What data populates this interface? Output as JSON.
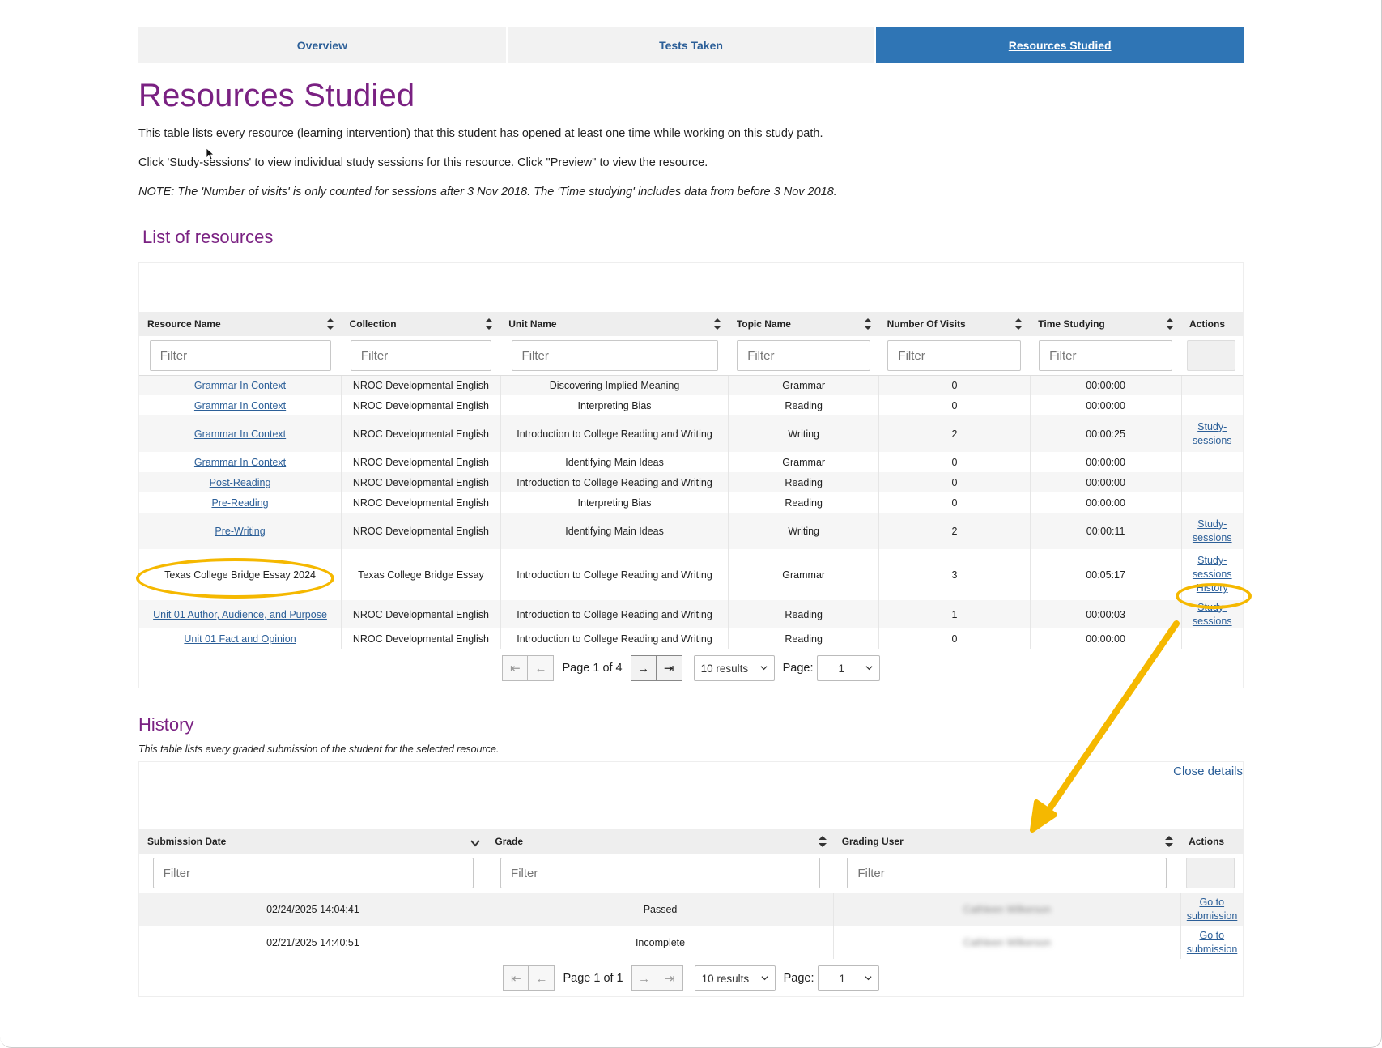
{
  "tabs": [
    {
      "label": "Overview",
      "active": false
    },
    {
      "label": "Tests Taken",
      "active": false
    },
    {
      "label": "Resources Studied",
      "active": true
    }
  ],
  "page_title": "Resources Studied",
  "intro": {
    "line1": "This table lists every resource (learning intervention) that this student has opened at least one time while working on this study path.",
    "line2": "Click 'Study-sessions' to view individual study sessions for this resource. Click \"Preview\" to view the resource.",
    "note": "NOTE: The 'Number of visits' is only counted for sessions after 3 Nov 2018. The 'Time studying' includes data from before 3 Nov 2018."
  },
  "resources": {
    "title": "List of resources",
    "columns": [
      "Resource Name",
      "Collection",
      "Unit Name",
      "Topic Name",
      "Number Of Visits",
      "Time Studying",
      "Actions"
    ],
    "filter_placeholder": "Filter",
    "rows": [
      {
        "name": "Grammar In Context",
        "collection": "NROC Developmental English",
        "unit": "Discovering Implied Meaning",
        "topic": "Grammar",
        "visits": "0",
        "time": "00:00:00",
        "actions": []
      },
      {
        "name": "Grammar In Context",
        "collection": "NROC Developmental English",
        "unit": "Interpreting Bias",
        "topic": "Reading",
        "visits": "0",
        "time": "00:00:00",
        "actions": []
      },
      {
        "name": "Grammar In Context",
        "collection": "NROC Developmental English",
        "unit": "Introduction to College Reading and Writing",
        "topic": "Writing",
        "visits": "2",
        "time": "00:00:25",
        "actions": [
          "Study-sessions"
        ]
      },
      {
        "name": "Grammar In Context",
        "collection": "NROC Developmental English",
        "unit": "Identifying Main Ideas",
        "topic": "Grammar",
        "visits": "0",
        "time": "00:00:00",
        "actions": []
      },
      {
        "name": "Post-Reading",
        "collection": "NROC Developmental English",
        "unit": "Introduction to College Reading and Writing",
        "topic": "Reading",
        "visits": "0",
        "time": "00:00:00",
        "actions": []
      },
      {
        "name": "Pre-Reading",
        "collection": "NROC Developmental English",
        "unit": "Interpreting Bias",
        "topic": "Reading",
        "visits": "0",
        "time": "00:00:00",
        "actions": []
      },
      {
        "name": "Pre-Writing",
        "collection": "NROC Developmental English",
        "unit": "Identifying Main Ideas",
        "topic": "Writing",
        "visits": "2",
        "time": "00:00:11",
        "actions": [
          "Study-sessions"
        ]
      },
      {
        "name": "Texas College Bridge Essay 2024",
        "collection": "Texas College Bridge Essay",
        "unit": "Introduction to College Reading and Writing",
        "topic": "Grammar",
        "visits": "3",
        "time": "00:05:17",
        "actions": [
          "Study-sessions",
          "History"
        ],
        "plain": true
      },
      {
        "name": "Unit 01 Author, Audience, and Purpose",
        "collection": "NROC Developmental English",
        "unit": "Introduction to College Reading and Writing",
        "topic": "Reading",
        "visits": "1",
        "time": "00:00:03",
        "actions": [
          "Study-sessions"
        ]
      },
      {
        "name": "Unit 01 Fact and Opinion",
        "collection": "NROC Developmental English",
        "unit": "Introduction to College Reading and Writing",
        "topic": "Reading",
        "visits": "0",
        "time": "00:00:00",
        "actions": []
      }
    ],
    "pager": {
      "page_text": "Page 1 of 4",
      "results": "10 results",
      "page_label": "Page:",
      "page_value": "1"
    }
  },
  "history": {
    "title": "History",
    "description": "This table lists every graded submission of the student for the selected resource.",
    "close_label": "Close details",
    "columns": [
      "Submission Date",
      "Grade",
      "Grading User",
      "Actions"
    ],
    "filter_placeholder": "Filter",
    "rows": [
      {
        "date": "02/24/2025 14:04:41",
        "grade": "Passed",
        "user": "Cathleen Wilkerson",
        "action": "Go to submission"
      },
      {
        "date": "02/21/2025 14:40:51",
        "grade": "Incomplete",
        "user": "Cathleen Wilkerson",
        "action": "Go to submission"
      }
    ],
    "pager": {
      "page_text": "Page 1 of 1",
      "results": "10 results",
      "page_label": "Page:",
      "page_value": "1"
    }
  },
  "annotation_color": "#f5b800",
  "link_color": "#2c5f98",
  "title_color": "#7a2182"
}
